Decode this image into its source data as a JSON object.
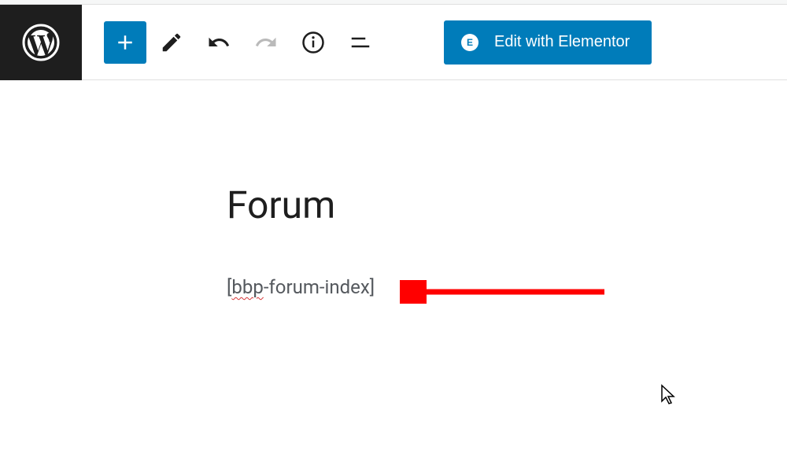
{
  "toolbar": {
    "elementor_label": "Edit with Elementor"
  },
  "content": {
    "page_title": "Forum",
    "shortcode_bracket_open": "[",
    "shortcode_error_part": "bbp",
    "shortcode_rest": "-forum-index]"
  }
}
